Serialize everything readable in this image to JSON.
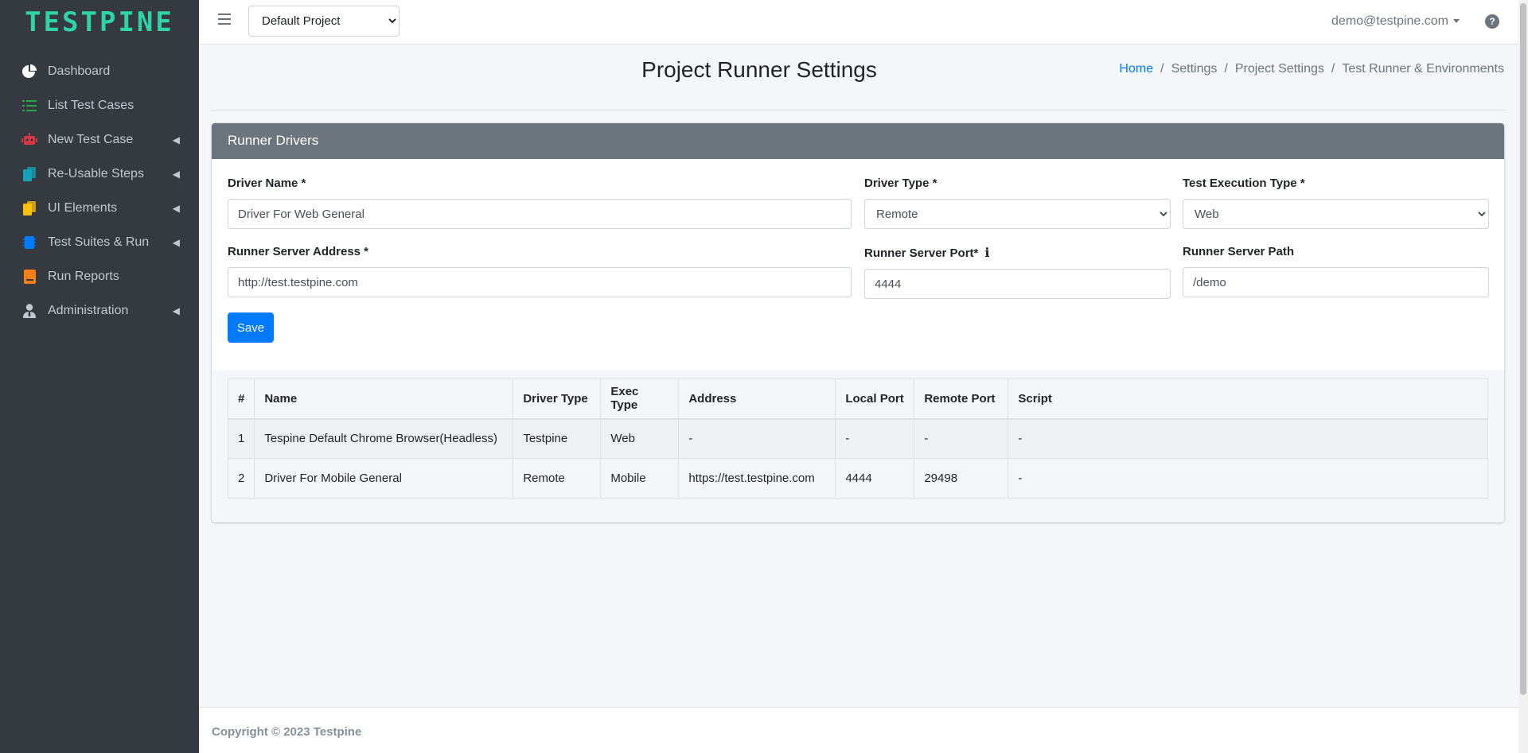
{
  "brand": {
    "name": "TESTPINE",
    "color": "#2ed3a6"
  },
  "sidebar": {
    "items": [
      {
        "label": "Dashboard",
        "icon": "pie-chart-icon",
        "icon_color": "#ffffff",
        "has_children": false
      },
      {
        "label": "List Test Cases",
        "icon": "list-icon",
        "icon_color": "#28a745",
        "has_children": false
      },
      {
        "label": "New Test Case",
        "icon": "robot-icon",
        "icon_color": "#dc3545",
        "has_children": true
      },
      {
        "label": "Re-Usable Steps",
        "icon": "copy-icon",
        "icon_color": "#17a2b8",
        "has_children": true
      },
      {
        "label": "UI Elements",
        "icon": "files-icon",
        "icon_color": "#ffc107",
        "has_children": true
      },
      {
        "label": "Test Suites & Run",
        "icon": "chip-icon",
        "icon_color": "#007bff",
        "has_children": true
      },
      {
        "label": "Run Reports",
        "icon": "book-icon",
        "icon_color": "#fd7e14",
        "has_children": false
      },
      {
        "label": "Administration",
        "icon": "user-tie-icon",
        "icon_color": "#c2c7d0",
        "has_children": true
      }
    ]
  },
  "topbar": {
    "project_selected": "Default Project",
    "user_email": "demo@testpine.com"
  },
  "page": {
    "title": "Project Runner Settings",
    "breadcrumb": [
      "Home",
      "Settings",
      "Project Settings",
      "Test Runner & Environments"
    ]
  },
  "card": {
    "header": "Runner Drivers",
    "form": {
      "driver_name_label": "Driver Name *",
      "driver_name_value": "Driver For Web General",
      "driver_type_label": "Driver Type *",
      "driver_type_value": "Remote",
      "exec_type_label": "Test Execution Type *",
      "exec_type_value": "Web",
      "server_address_label": "Runner Server Address *",
      "server_address_value": "http://test.testpine.com",
      "server_port_label": "Runner Server Port*",
      "server_port_value": "4444",
      "server_path_label": "Runner Server Path",
      "server_path_value": "/demo",
      "save_label": "Save"
    }
  },
  "table": {
    "columns": [
      "#",
      "Name",
      "Driver Type",
      "Exec Type",
      "Address",
      "Local Port",
      "Remote Port",
      "Script"
    ],
    "rows": [
      [
        "1",
        "Tespine Default Chrome Browser(Headless)",
        "Testpine",
        "Web",
        "-",
        "-",
        "-",
        "-"
      ],
      [
        "2",
        "Driver For Mobile General",
        "Remote",
        "Mobile",
        "https://test.testpine.com",
        "4444",
        "29498",
        "-"
      ]
    ]
  },
  "footer": {
    "text": "Copyright © 2023 Testpine"
  },
  "colors": {
    "primary": "#007bff",
    "sidebar_bg": "#343a40",
    "card_header": "#6c757d"
  }
}
